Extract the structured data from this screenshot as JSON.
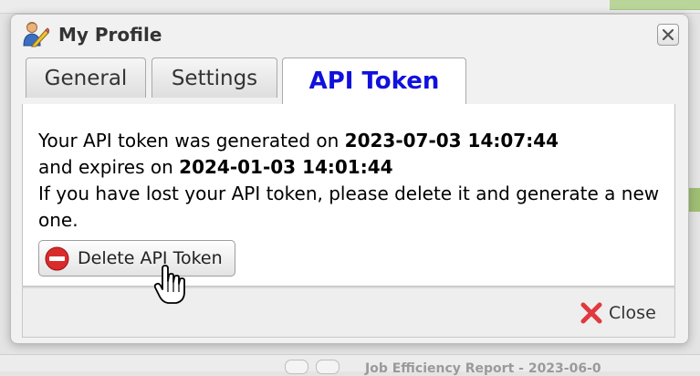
{
  "dialog": {
    "title": "My Profile",
    "title_icon": "user-edit-icon",
    "close_icon": "close-icon"
  },
  "tabs": [
    {
      "label": "General",
      "active": false
    },
    {
      "label": "Settings",
      "active": false
    },
    {
      "label": "API Token",
      "active": true
    }
  ],
  "message": {
    "line1_prefix": "Your API token was generated on",
    "generated_on": "2023-07-03 14:07:44",
    "line2_prefix": "and expires on",
    "expires_on": "2024-01-03 14:01:44",
    "line3": "If you have lost your API token, please delete it and generate a new one."
  },
  "delete_button": {
    "label": "Delete API Token",
    "icon": "no-entry-icon"
  },
  "footer": {
    "close_label": "Close",
    "close_icon": "red-x-icon"
  },
  "background": {
    "bottom_text": "Job Efficiency Report - 2023-06-0"
  },
  "colors": {
    "active_tab_text": "#1111dd",
    "delete_icon": "#d92b2b",
    "close_icon": "#e0393e"
  }
}
